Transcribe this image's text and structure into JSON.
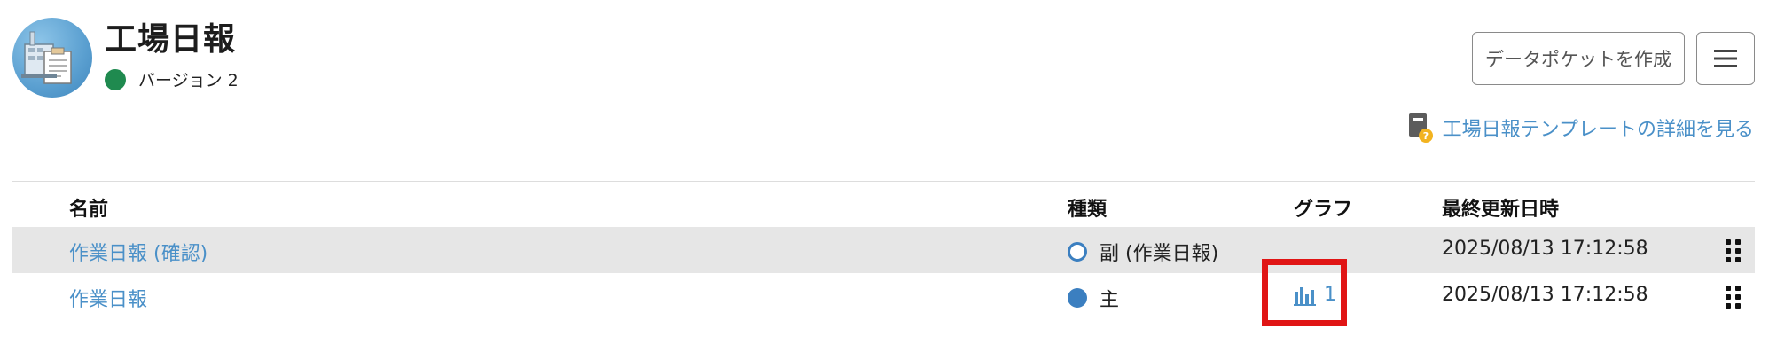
{
  "header": {
    "title": "工場日報",
    "version_label": "バージョン 2",
    "create_button_label": "データポケットを作成",
    "detail_link_label": "工場日報テンプレートの詳細を見る"
  },
  "table": {
    "columns": {
      "name": "名前",
      "type": "種類",
      "graph": "グラフ",
      "updated": "最終更新日時"
    },
    "rows": [
      {
        "name": "作業日報 (確認)",
        "type": "副 (作業日報)",
        "type_style": "hollow",
        "graph_count": "",
        "updated": "2025/08/13 17:12:58"
      },
      {
        "name": "作業日報",
        "type": "主",
        "type_style": "solid",
        "graph_count": "1",
        "updated": "2025/08/13 17:12:58"
      }
    ]
  },
  "colors": {
    "link": "#4a90c8",
    "version_status": "#1f8a4f",
    "type_dot": "#3b7fc0",
    "highlight": "#e01515",
    "shaded_row": "#e6e6e6"
  },
  "icons": {
    "app": "factory-report-icon",
    "menu": "hamburger-icon",
    "detail": "template-info-icon",
    "graph": "bar-chart-icon",
    "drag": "drag-handle-icon"
  }
}
